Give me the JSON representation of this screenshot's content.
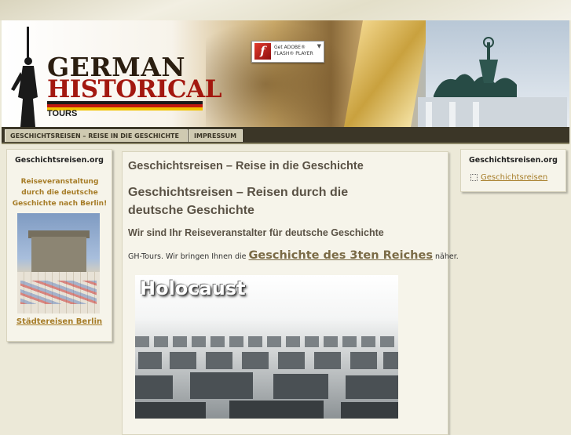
{
  "header": {
    "logo": {
      "line1": "GERMAN",
      "line2": "HISTORICAL",
      "line3": "TOURS"
    },
    "flash": {
      "line1": "Get ADOBE®",
      "line2": "FLASH® PLAYER",
      "icon": "flash-icon"
    }
  },
  "nav": {
    "tabs": [
      {
        "label": "GESCHICHTSREISEN – REISE IN DIE GESCHICHTE"
      },
      {
        "label": "IMPRESSUM"
      }
    ]
  },
  "left_sidebar": {
    "heading": "Geschichtsreisen.org",
    "tagline": "Reiseveranstaltung durch die deutsche Geschichte nach Berlin!",
    "link": "Städtereisen Berlin"
  },
  "main": {
    "title": "Geschichtsreisen – Reise in die Geschichte",
    "subtitle": "Geschichtsreisen – Reisen durch die deutsche Geschichte",
    "tagline": "Wir sind Ihr Reiseveranstalter für deutsche Geschichte",
    "intro_prefix": "GH-Tours. Wir bringen Ihnen die",
    "intro_link": "Geschichte des 3ten Reiches",
    "intro_suffix": "näher.",
    "image_caption": "Holocaust"
  },
  "right_sidebar": {
    "heading": "Geschichtsreisen.org",
    "items": [
      {
        "label": "Geschichtsreisen"
      }
    ]
  },
  "colors": {
    "accent": "#a67c27",
    "nav_bg": "#3b3627",
    "logo_red": "#a3180f",
    "logo_gold": "#f2c300"
  }
}
